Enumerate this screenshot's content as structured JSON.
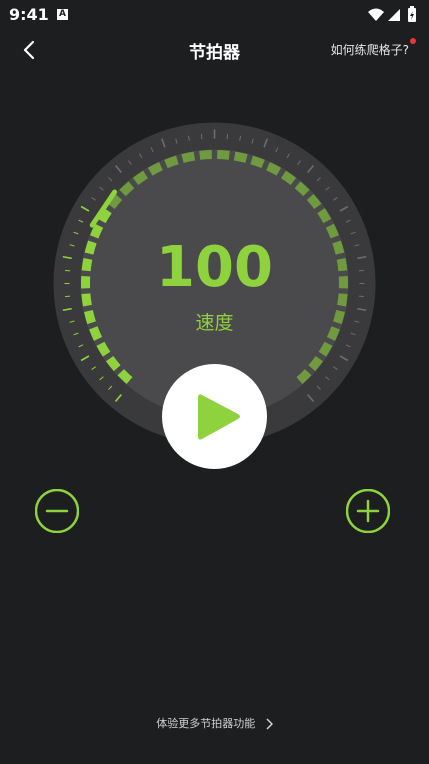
{
  "status_bar": {
    "time": "9:41",
    "sim_label": "A",
    "icons": [
      "wifi-icon",
      "signal-icon",
      "battery-icon"
    ]
  },
  "header": {
    "title": "节拍器",
    "help_link": "如何练爬格子?",
    "back_icon": "chevron-left-icon"
  },
  "dial": {
    "bpm": "100",
    "bpm_label": "速度",
    "accent_color": "#8ed23d",
    "dim_color": "#6f9a3f",
    "face_color": "#4a4a4c",
    "rim_color": "#3a3a3c"
  },
  "controls": {
    "play_icon": "play-icon",
    "minus_icon": "minus-circle-icon",
    "plus_icon": "plus-circle-icon"
  },
  "footer": {
    "more_link": "体验更多节拍器功能"
  }
}
